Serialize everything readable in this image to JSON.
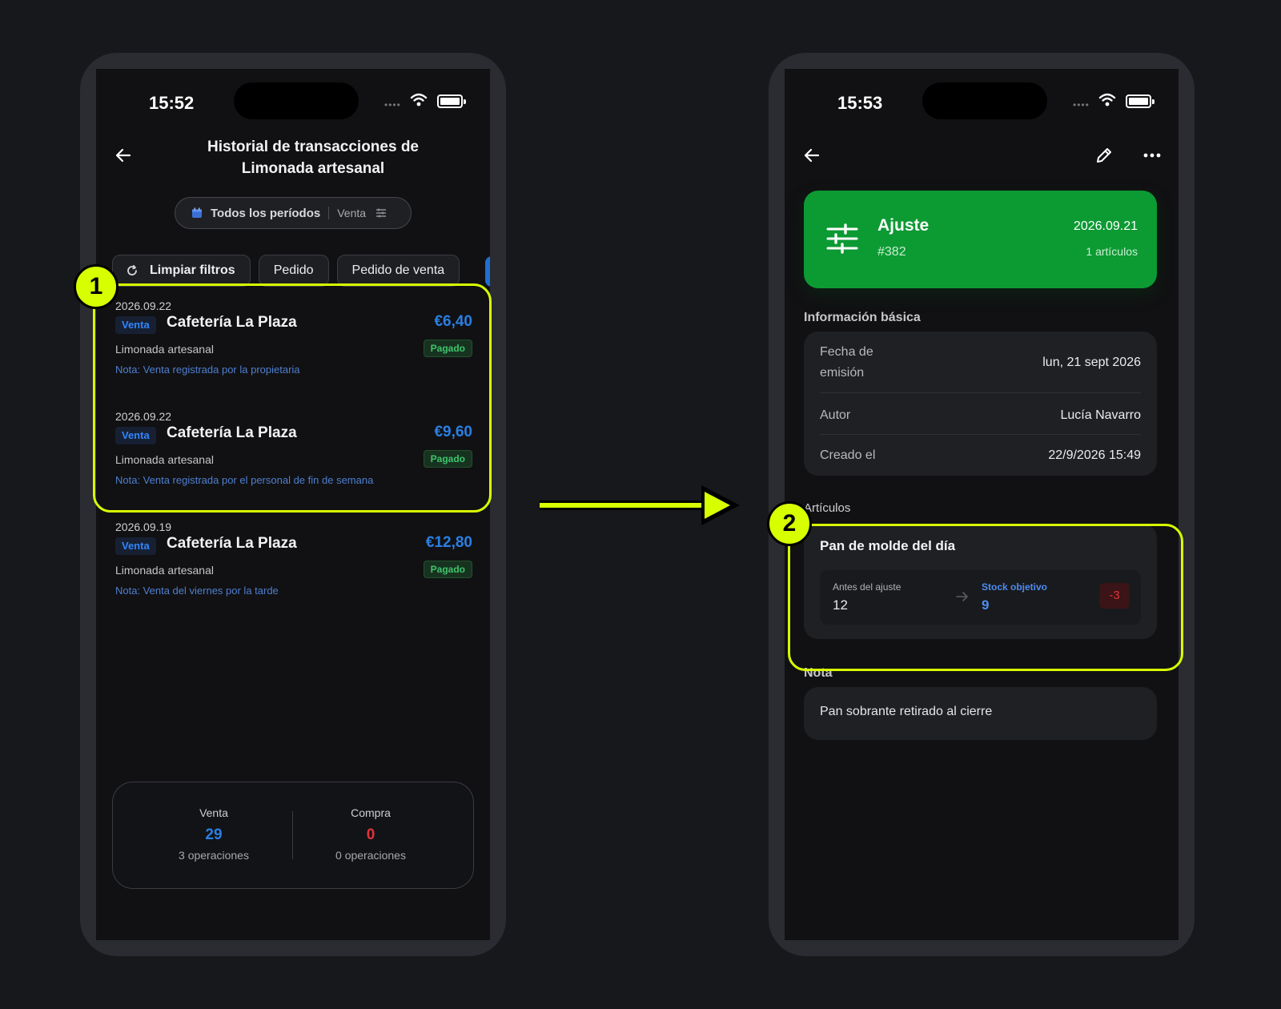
{
  "left": {
    "status": {
      "time": "15:52",
      "signal": "••••"
    },
    "title": "Historial de transacciones de Limonada artesanal",
    "period_filter": {
      "label": "Todos los períodos",
      "type": "Venta"
    },
    "chips": {
      "clear": "Limpiar filtros",
      "order": "Pedido",
      "sales_order": "Pedido de venta"
    },
    "transactions": [
      {
        "date": "2026.09.22",
        "type": "Venta",
        "customer": "Cafetería La Plaza",
        "amount": "€6,40",
        "product": "Limonada artesanal",
        "status": "Pagado",
        "note": "Nota: Venta registrada por la propietaria"
      },
      {
        "date": "2026.09.22",
        "type": "Venta",
        "customer": "Cafetería La Plaza",
        "amount": "€9,60",
        "product": "Limonada artesanal",
        "status": "Pagado",
        "note": "Nota: Venta registrada por el personal de fin de semana"
      },
      {
        "date": "2026.09.19",
        "type": "Venta",
        "customer": "Cafetería La Plaza",
        "amount": "€12,80",
        "product": "Limonada artesanal",
        "status": "Pagado",
        "note": "Nota: Venta del viernes por la tarde"
      }
    ],
    "summary": {
      "sale": {
        "label": "Venta",
        "value": "29",
        "ops": "3 operaciones"
      },
      "purchase": {
        "label": "Compra",
        "value": "0",
        "ops": "0 operaciones"
      }
    }
  },
  "right": {
    "status": {
      "time": "15:53",
      "signal": "••••"
    },
    "hero": {
      "title": "Ajuste",
      "number": "#382",
      "date": "2026.09.21",
      "count": "1 artículos"
    },
    "basic_info": {
      "heading": "Información básica",
      "rows": [
        {
          "key": "Fecha de emisión",
          "value": "lun, 21 sept 2026"
        },
        {
          "key": "Autor",
          "value": "Lucía Navarro"
        },
        {
          "key": "Creado el",
          "value": "22/9/2026 15:49"
        }
      ]
    },
    "items": {
      "heading": "Artículos",
      "name": "Pan de molde del día",
      "before_label": "Antes del ajuste",
      "before_value": "12",
      "target_label": "Stock objetivo",
      "target_value": "9",
      "diff": "-3"
    },
    "note": {
      "heading": "Nota",
      "text": "Pan sobrante retirado al cierre"
    }
  },
  "annotations": {
    "marker1": "1",
    "marker2": "2"
  },
  "colors": {
    "highlight": "#d8ff00",
    "hero": "#0c9a33",
    "accent_blue": "#2a7fe3",
    "negative": "#e0343a",
    "paid_green": "#3fc46b"
  },
  "icons": [
    "back-arrow-icon",
    "calendar-icon",
    "filter-sliders-icon",
    "refresh-icon",
    "edit-pencil-icon",
    "more-dots-icon",
    "adjust-sliders-icon",
    "wifi-icon",
    "battery-icon"
  ]
}
